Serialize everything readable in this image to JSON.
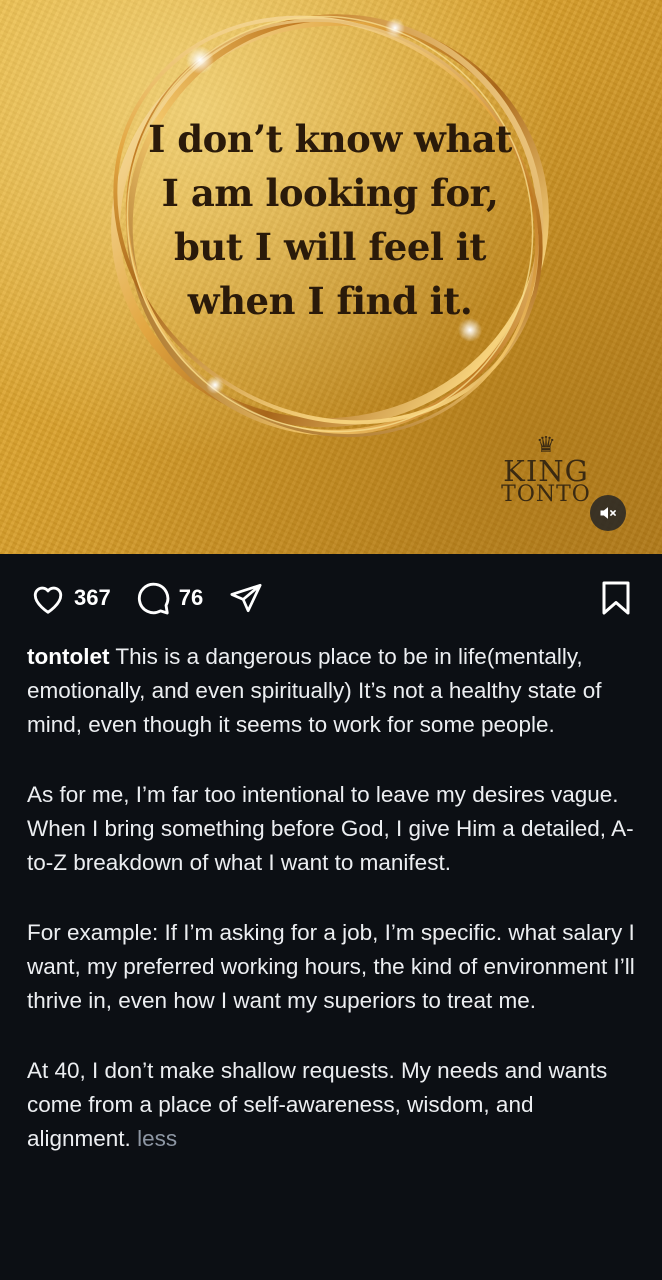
{
  "post": {
    "quote_lines": [
      "I don’t know what",
      "I am looking for,",
      "but I will feel it",
      "when I find it."
    ],
    "brand": {
      "line1": "KING",
      "line2": "TONTO"
    },
    "mute_icon": "speaker-muted-icon"
  },
  "actions": {
    "like_icon": "heart-icon",
    "like_count": "367",
    "comment_icon": "comment-bubble-icon",
    "comment_count": "76",
    "share_icon": "paper-plane-icon",
    "save_icon": "bookmark-icon"
  },
  "caption": {
    "username": "tontolet",
    "paragraphs": [
      "This is a dangerous place to be in life(mentally, emotionally, and even spiritually) It’s not a healthy state of mind, even though it seems to work for some people.",
      "As for me, I’m far too intentional to leave my desires vague. When I bring something before God, I give Him a detailed, A-to-Z breakdown of what I want to manifest.",
      "For example: If I’m asking for a job, I’m specific. what salary I want, my preferred working hours, the kind of environment I’ll thrive in, even how I want my superiors to treat me.",
      "At 40, I don’t make shallow requests. My needs and wants come from a place of self-awareness, wisdom, and alignment."
    ],
    "less_label": "less"
  },
  "colors": {
    "background": "#0c0f14",
    "gold": "#d9a02c",
    "text": "#eceef1",
    "muted": "#8d96a3"
  }
}
